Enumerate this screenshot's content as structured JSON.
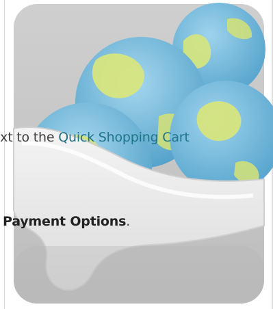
{
  "figure": {
    "icon": "cart-globe-icon",
    "colors": {
      "background": "#ffffff",
      "frame": "#c9c9c9",
      "globe_blue": "#76b9db",
      "globe_green": "#d6e37b",
      "tray": "#ececec",
      "text": "#3d3d3d",
      "link": "#1f7488"
    }
  },
  "instruction": {
    "line1_before": "ext to the ",
    "line1_link": "Quick Shopping Cart",
    "line2_bold": "Payment Options",
    "line2_after": "."
  }
}
